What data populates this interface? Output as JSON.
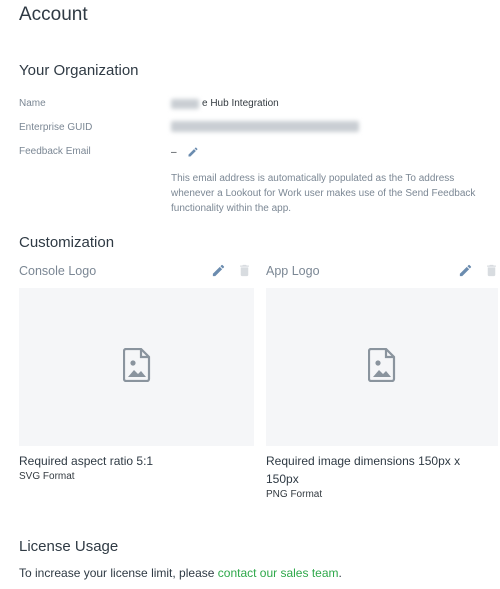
{
  "page": {
    "title": "Account"
  },
  "organization": {
    "heading": "Your Organization",
    "name_label": "Name",
    "name_visible": "e Hub Integration",
    "guid_label": "Enterprise GUID",
    "feedback_label": "Feedback Email",
    "feedback_value": "–",
    "help_text": "This email address is automatically populated as the To address whenever a Lookout for Work user makes use of the Send Feedback functionality within the app."
  },
  "customization": {
    "heading": "Customization",
    "console_logo": {
      "title": "Console Logo",
      "requirement": "Required aspect ratio 5:1",
      "format": "SVG Format"
    },
    "app_logo": {
      "title": "App Logo",
      "requirement_line1": "Required image dimensions 150px x",
      "requirement_line2": "150px",
      "format": "PNG Format"
    }
  },
  "license": {
    "heading": "License Usage",
    "text": "To increase your license limit, please ",
    "link": "contact our sales team",
    "suffix": "."
  },
  "colors": {
    "link": "#2ea84a",
    "edit_icon": "#6b8caf",
    "muted_icon": "#d8dce0",
    "preview_bg": "#f5f6f8"
  },
  "icons": {
    "edit": "pencil-icon",
    "delete": "trash-icon",
    "placeholder": "image-file-icon"
  }
}
